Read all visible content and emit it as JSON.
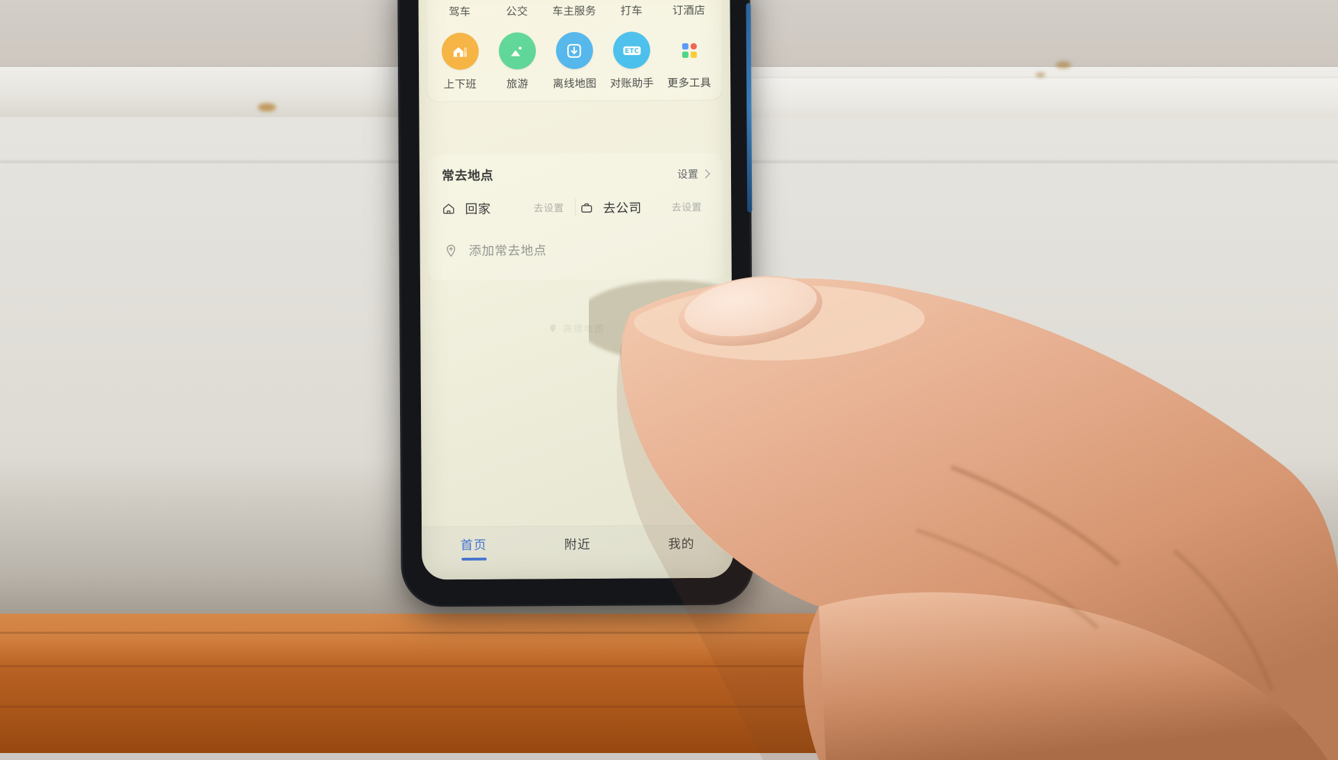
{
  "app": {
    "name": "amap-home-screen",
    "watermark": "高德地图"
  },
  "tools_card": {
    "items": [
      {
        "label": "驾车",
        "icon": "car-icon",
        "color": "#34a3ee"
      },
      {
        "label": "公交",
        "icon": "bus-icon",
        "color": "#3fd08a"
      },
      {
        "label": "车主服务",
        "icon": "driver-icon",
        "color": "#f7573f"
      },
      {
        "label": "打车",
        "icon": "taxi-hail-icon",
        "color": "#2aade3"
      },
      {
        "label": "订酒店",
        "icon": "hotel-icon",
        "color": "#f99b1c"
      },
      {
        "label": "上下班",
        "icon": "commute-icon",
        "color": "#f5a523"
      },
      {
        "label": "旅游",
        "icon": "travel-icon",
        "color": "#3fd08a"
      },
      {
        "label": "离线地图",
        "icon": "download-map-icon",
        "color": "#35aaf0"
      },
      {
        "label": "对账助手",
        "icon": "etc-icon",
        "color": "#2cb6f0"
      },
      {
        "label": "更多工具",
        "icon": "more-tools-icon",
        "color": "#ffffff"
      }
    ],
    "more_tools_colors": [
      "#3d8bff",
      "#f04a3c",
      "#2fcf7a",
      "#fcc419"
    ]
  },
  "favorites": {
    "title": "常去地点",
    "settings_label": "设置",
    "entries": [
      {
        "icon": "home-icon",
        "name": "回家",
        "action": "去设置"
      },
      {
        "icon": "briefcase-icon",
        "name": "去公司",
        "action": "去设置"
      }
    ],
    "add": {
      "icon": "pin-plus-icon",
      "label": "添加常去地点"
    }
  },
  "bottom_nav": {
    "tabs": [
      {
        "label": "首页",
        "active": true
      },
      {
        "label": "附近",
        "active": false
      },
      {
        "label": "我的",
        "active": false
      }
    ],
    "active_color": "#2b63d9"
  }
}
